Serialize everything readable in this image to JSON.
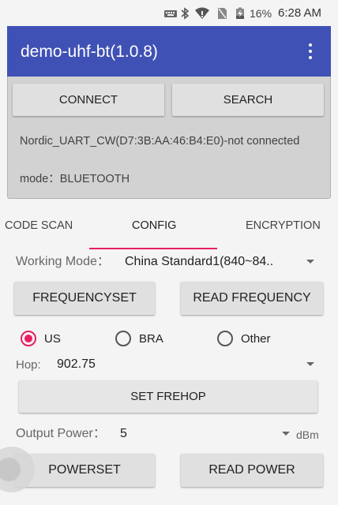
{
  "status_bar": {
    "battery_percent": "16%",
    "time": "6:28 AM",
    "icons": [
      "keyboard-icon",
      "bluetooth-icon",
      "wifi-icon",
      "sim-icon",
      "battery-charging-icon"
    ]
  },
  "app_bar": {
    "title": "demo-uhf-bt(1.0.8)",
    "overflow_icon": "overflow-menu-icon",
    "color": "#3f51b5"
  },
  "connection": {
    "connect_label": "CONNECT",
    "search_label": "SEARCH",
    "device_status": "Nordic_UART_CW(D7:3B:AA:46:B4:E0)-not connected",
    "mode": "mode：BLUETOOTH"
  },
  "tabs": {
    "items": [
      {
        "label": "CODE SCAN",
        "selected": false
      },
      {
        "label": "CONFIG",
        "selected": true
      },
      {
        "label": "ENCRYPTION",
        "selected": false
      }
    ],
    "indicator_color": "#e91e63"
  },
  "config": {
    "working_mode_label": "Working Mode：",
    "working_mode_value": "China Standard1(840~84..",
    "frequencyset_label": "FREQUENCYSET",
    "read_frequency_label": "READ FREQUENCY",
    "regions": [
      {
        "label": "US",
        "checked": true
      },
      {
        "label": "BRA",
        "checked": false
      },
      {
        "label": "Other",
        "checked": false
      }
    ],
    "hop_label": "Hop:",
    "hop_value": "902.75",
    "set_frehop_label": "SET FREHOP",
    "output_power_label": "Output Power：",
    "output_power_value": "5",
    "output_power_unit": "dBm",
    "powerset_label": "POWERSET",
    "read_power_label": "READ POWER"
  }
}
